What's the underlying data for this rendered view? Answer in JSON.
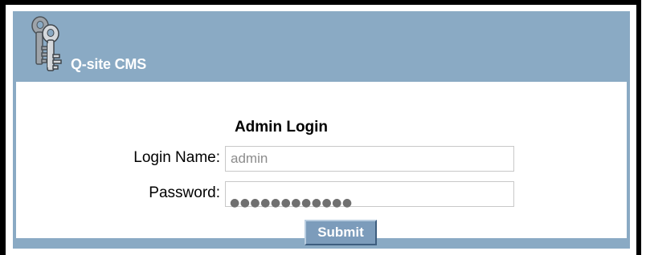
{
  "header": {
    "title": "Q-site CMS",
    "icon": "keys-icon"
  },
  "login": {
    "title": "Admin Login",
    "username_label": "Login Name:",
    "username_value": "admin",
    "password_label": "Password:",
    "password_masked": "●●●●●●●●●●●●",
    "submit_label": "Submit"
  },
  "colors": {
    "panel": "#8aaac4",
    "button": "#7c9cbb",
    "frame": "#000000"
  }
}
